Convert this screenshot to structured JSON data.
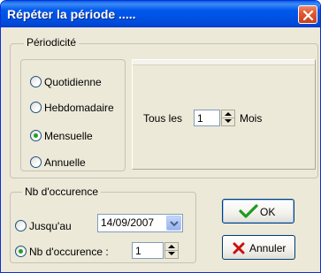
{
  "window": {
    "title": "Répéter la période ....."
  },
  "periodicite": {
    "legend": "Périodicité",
    "options": [
      {
        "label": "Quotidienne",
        "selected": false
      },
      {
        "label": "Hebdomadaire",
        "selected": false
      },
      {
        "label": "Mensuelle",
        "selected": true
      },
      {
        "label": "Annuelle",
        "selected": false
      }
    ],
    "panel": {
      "prefix": "Tous les",
      "value": "1",
      "unit": "Mois"
    }
  },
  "occurrence": {
    "legend": "Nb d'occurence",
    "until": {
      "label": "Jusqu'au",
      "selected": false,
      "date": "14/09/2007"
    },
    "count": {
      "label": "Nb d'occurence :",
      "selected": true,
      "value": "1"
    }
  },
  "buttons": {
    "ok": "OK",
    "cancel": "Annuler"
  },
  "colors": {
    "accent_green": "#21a121",
    "title_blue": "#0054e3",
    "cancel_red": "#cc1010"
  }
}
